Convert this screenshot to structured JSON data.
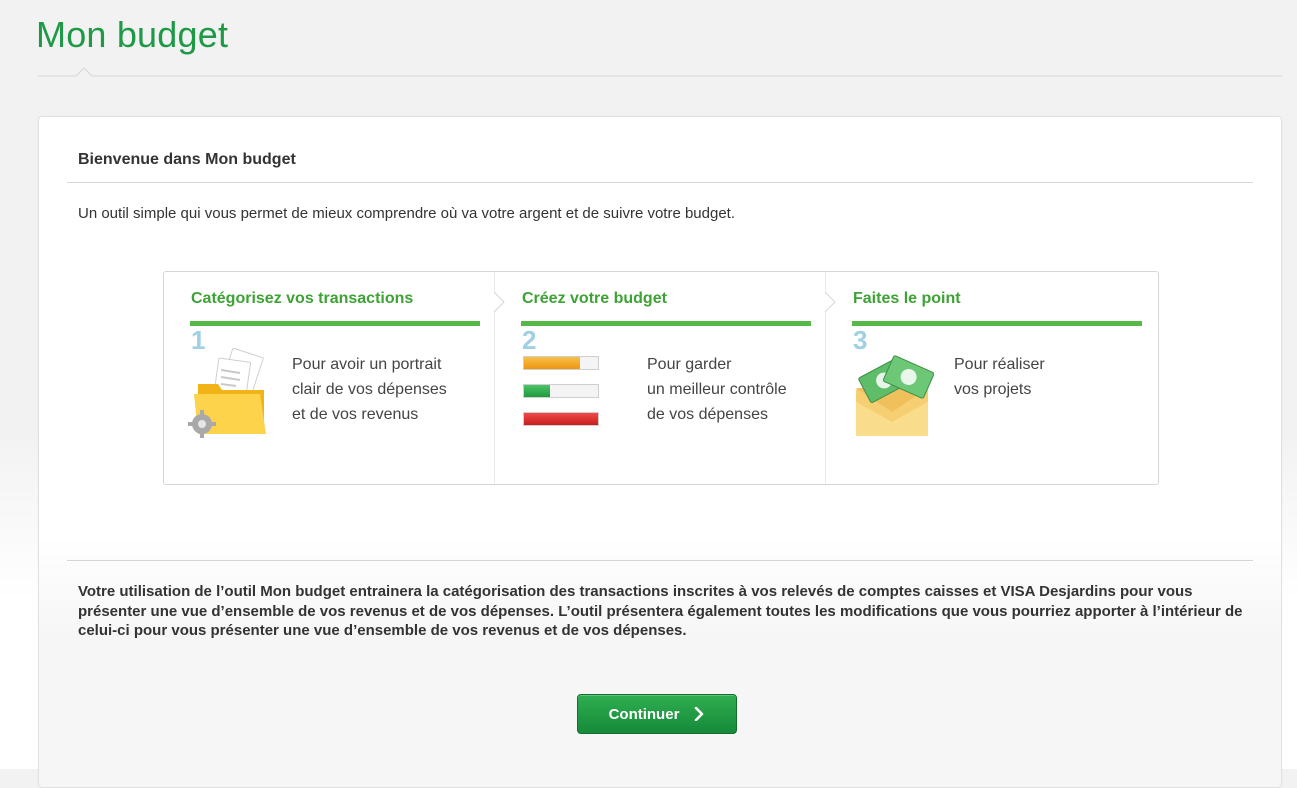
{
  "page": {
    "title": "Mon budget"
  },
  "welcome": {
    "title": "Bienvenue dans Mon budget",
    "intro": "Un outil simple qui vous permet de mieux comprendre où va votre argent et de suivre votre budget."
  },
  "steps": [
    {
      "title": "Catégorisez vos transactions",
      "number": "1",
      "icon": "folder-documents-gear-icon",
      "lines": [
        "Pour avoir un portrait",
        "clair de vos dépenses",
        "et de vos revenus"
      ]
    },
    {
      "title": "Créez votre budget",
      "number": "2",
      "icon": "budget-progress-bars-icon",
      "lines": [
        "Pour garder",
        "un meilleur contrôle",
        "de vos dépenses"
      ]
    },
    {
      "title": "Faites le point",
      "number": "3",
      "icon": "envelope-money-icon",
      "lines": [
        "Pour réaliser",
        "vos projets"
      ]
    }
  ],
  "budget_bars": [
    {
      "status": "orange",
      "fill": 0.75
    },
    {
      "status": "green",
      "fill": 0.35
    },
    {
      "status": "red",
      "fill": 1.0
    }
  ],
  "disclaimer": "Votre utilisation de l’outil Mon budget entrainera la catégorisation des transactions inscrites à vos relevés de comptes caisses et VISA Desjardins pour vous présenter une vue d’ensemble de vos revenus et de vos dépenses. L’outil présentera également toutes les modifications que vous pourriez apporter à l’intérieur de celui-ci pour vous présenter une vue d’ensemble de vos revenus et de vos dépenses.",
  "actions": {
    "continue_label": "Continuer",
    "continue_icon": "chevron-right-icon"
  },
  "colors": {
    "brand_green": "#1e9a47",
    "step_title_green": "#3da334",
    "step_bar_green": "#56b847",
    "step_number_blue": "#9fd1e3",
    "bar_orange": "#f0a01e",
    "bar_green": "#2aa84a",
    "bar_red": "#d9262b"
  }
}
